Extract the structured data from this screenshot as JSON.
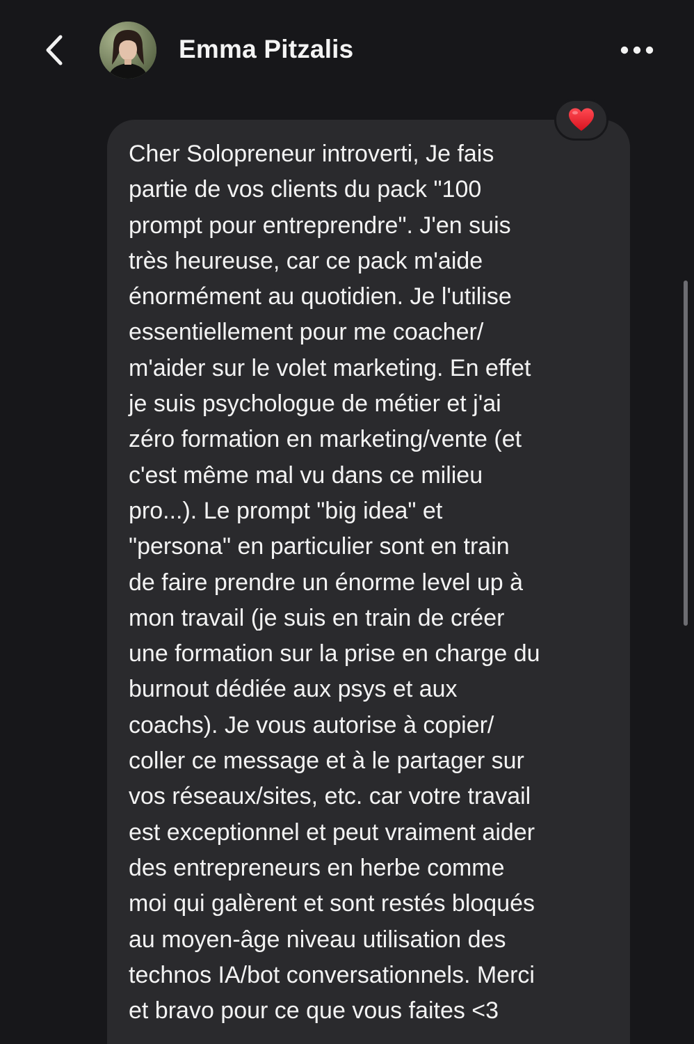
{
  "header": {
    "back_icon": "chevron-left-icon",
    "contact_name": "Emma Pitzalis",
    "avatar_icon": "profile-photo",
    "more_icon": "ellipsis-horizontal-icon"
  },
  "message": {
    "text": "Cher Solopreneur introverti, Je fais\npartie de vos clients du pack \"100\nprompt pour entreprendre\". J'en suis\ntrès heureuse, car ce pack m'aide\nénormément au quotidien. Je l'utilise\nessentiellement pour me coacher/\nm'aider sur le volet marketing. En effet\nje suis psychologue de métier et j'ai\nzéro formation en marketing/vente (et\nc'est même mal vu dans ce milieu\npro...). Le prompt \"big idea\" et\n\"persona\" en particulier sont en train\nde faire prendre un énorme level up à\nmon travail (je suis en train de créer\nune formation sur la prise en charge du\nburnout dédiée aux psys et aux\ncoachs). Je vous autorise à copier/\ncoller ce message et à le partager sur\nvos réseaux/sites, etc. car votre travail\nest exceptionnel et peut vraiment aider\ndes entrepreneurs en herbe comme\nmoi qui galèrent et sont restés bloqués\nau moyen-âge niveau utilisation des\ntechnos IA/bot conversationnels. Merci\net bravo pour ce que vous faites <3",
    "reaction": "❤️",
    "reaction_icon": "heart-icon"
  },
  "colors": {
    "background": "#17171a",
    "bubble": "#2a2a2d",
    "text": "#f3f3f3",
    "reaction_heart": "#e8242f"
  }
}
